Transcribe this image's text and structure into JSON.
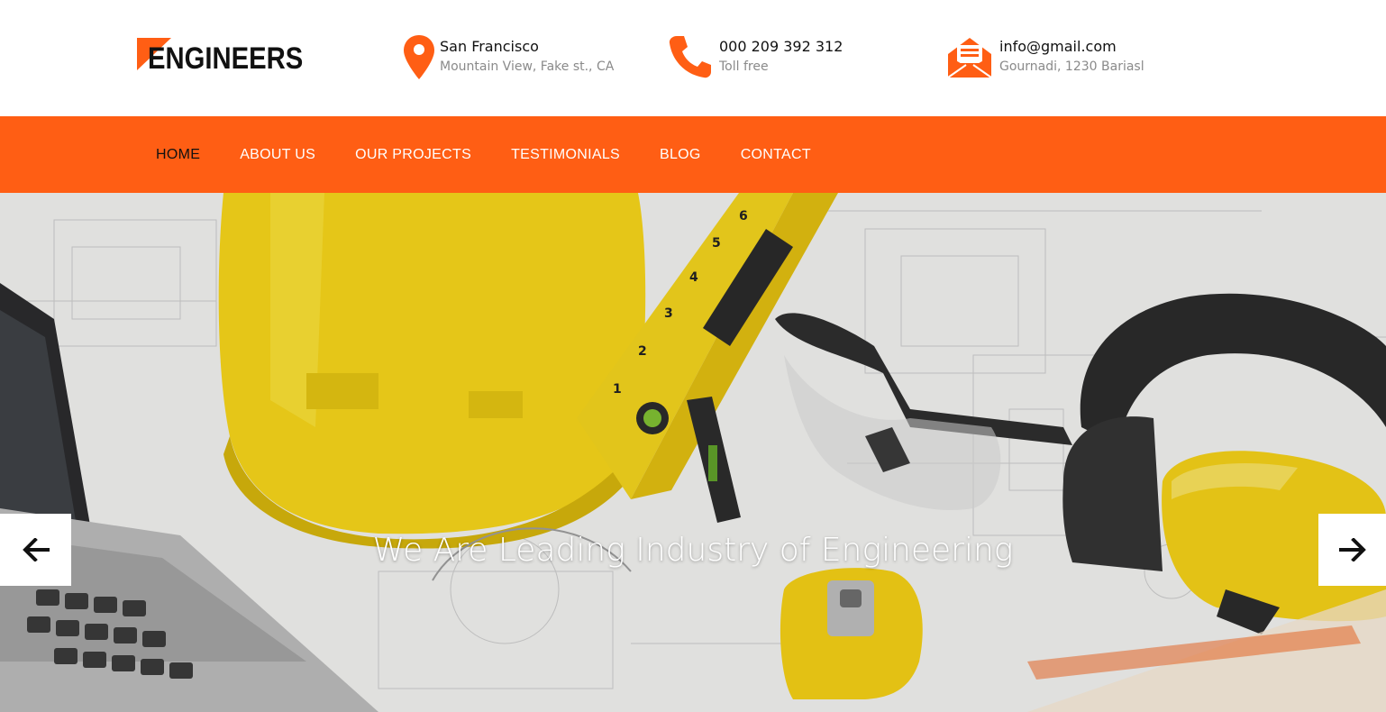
{
  "brand": {
    "name": "ENGINEERS",
    "accent": "#ff5e14",
    "text_color": "#111111"
  },
  "contacts": [
    {
      "icon": "map-pin-icon",
      "title": "San Francisco",
      "subtitle": "Mountain View, Fake st., CA"
    },
    {
      "icon": "phone-icon",
      "title": "000 209 392 312",
      "subtitle": "Toll free"
    },
    {
      "icon": "envelope-icon",
      "title": "info@gmail.com",
      "subtitle": "Gournadi, 1230 Bariasl"
    }
  ],
  "nav": {
    "items": [
      {
        "label": "HOME",
        "active": true
      },
      {
        "label": "ABOUT US",
        "active": false
      },
      {
        "label": "OUR PROJECTS",
        "active": false
      },
      {
        "label": "TESTIMONIALS",
        "active": false
      },
      {
        "label": "BLOG",
        "active": false
      },
      {
        "label": "CONTACT",
        "active": false
      }
    ]
  },
  "hero": {
    "title": "We Are Leading Industry of Engineering",
    "prev_icon": "arrow-left-icon",
    "next_icon": "arrow-right-icon"
  }
}
